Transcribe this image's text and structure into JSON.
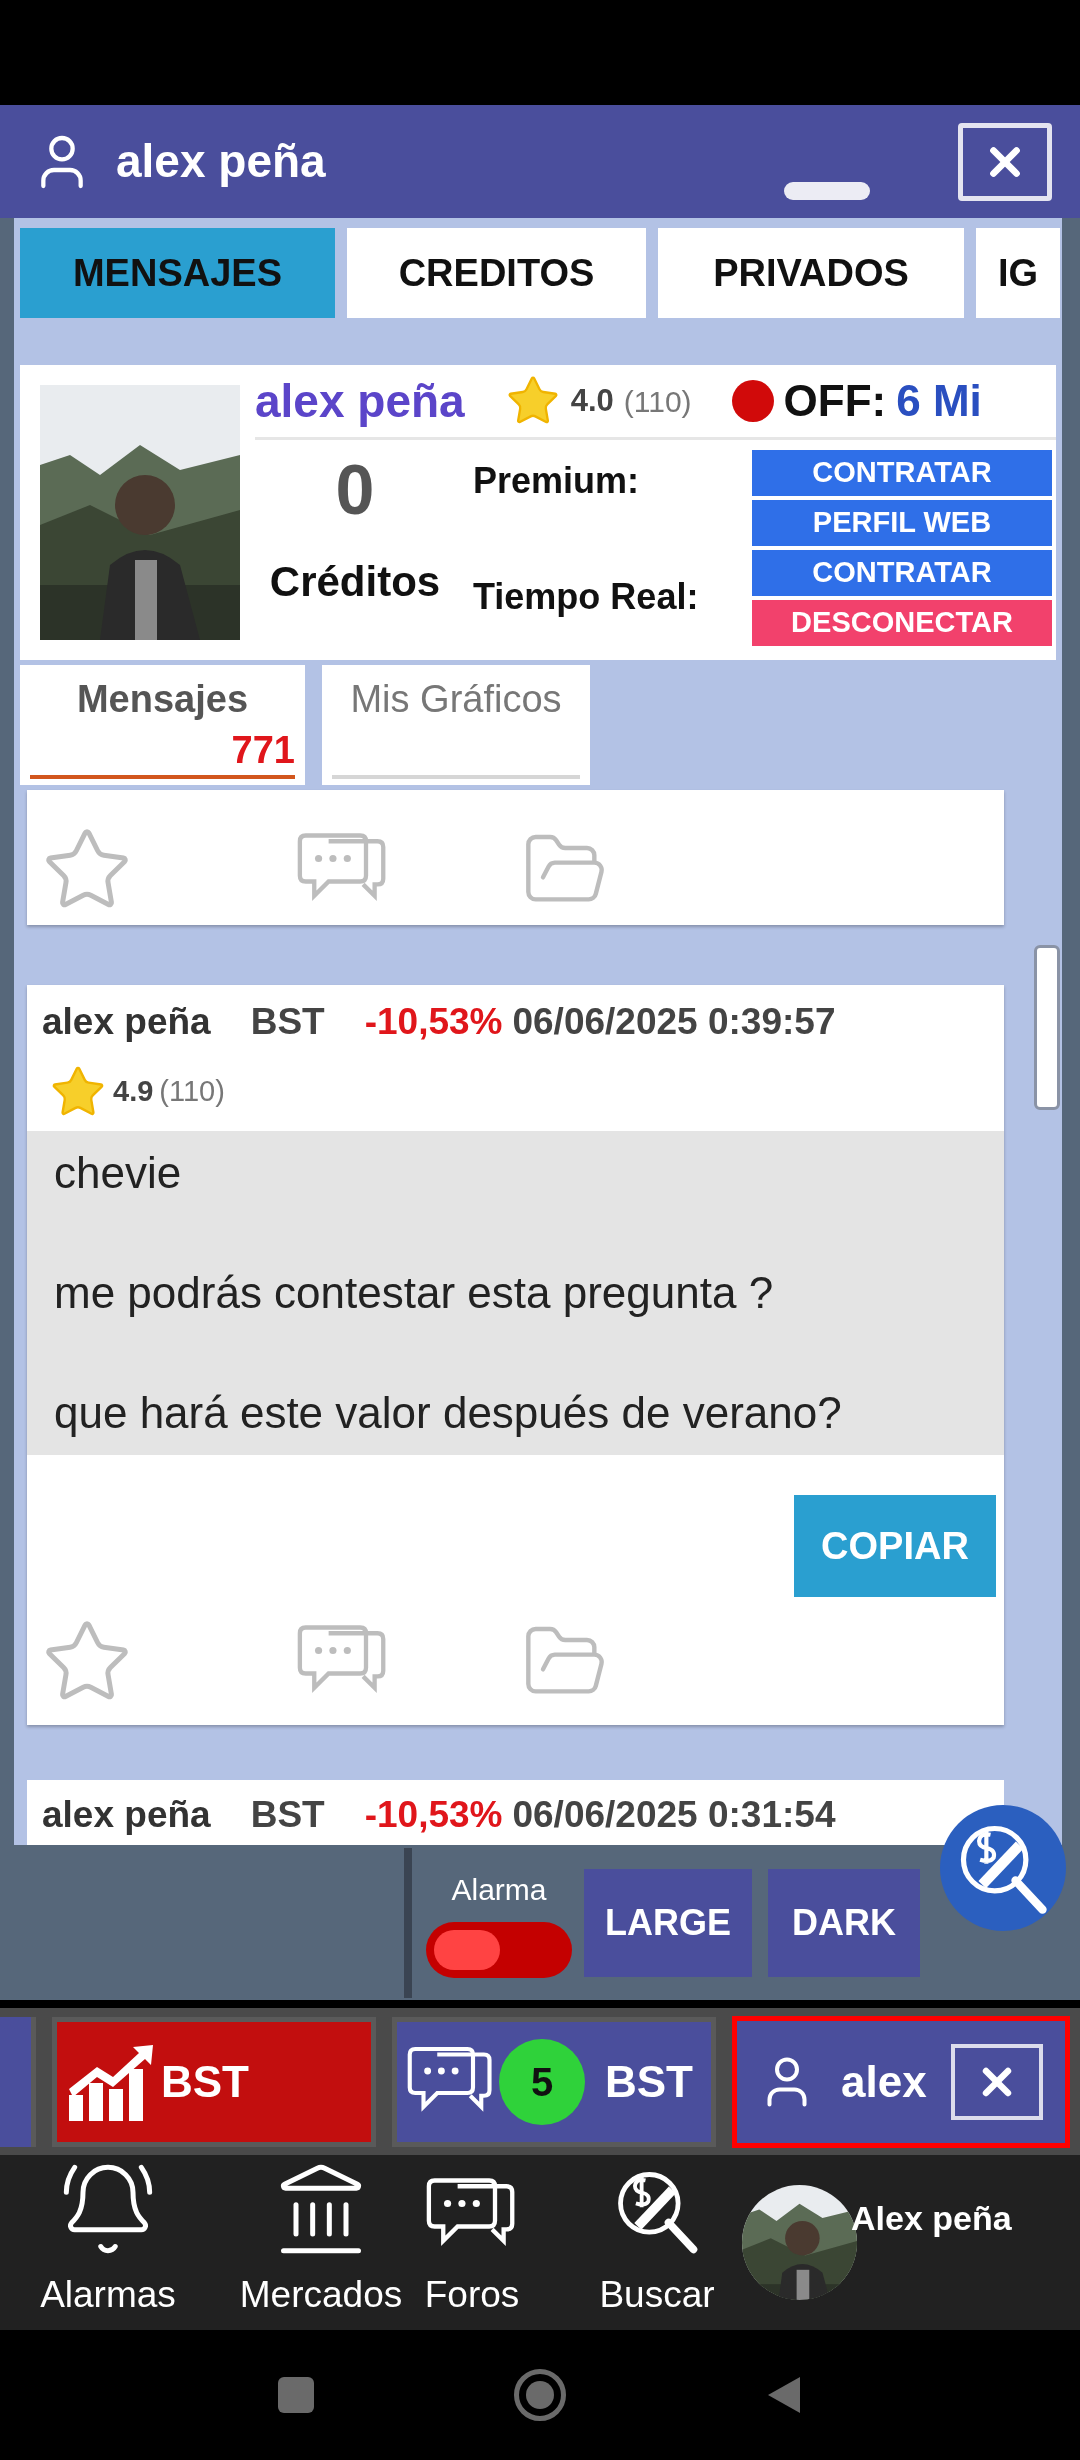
{
  "window": {
    "title": "alex peña"
  },
  "tabs": [
    {
      "label": "MENSAJES",
      "selected": true
    },
    {
      "label": "CREDITOS",
      "selected": false
    },
    {
      "label": "PRIVADOS",
      "selected": false
    },
    {
      "label": "IG",
      "selected": false
    }
  ],
  "profile": {
    "name": "alex peña",
    "rating": "4.0",
    "rating_count": "(110)",
    "online": false,
    "status": "OFF:",
    "status_detail": "6 Mi",
    "credits": "0",
    "credits_label": "Créditos",
    "premium_label": "Premium:",
    "premium_button": "CONTRATAR",
    "web_button": "PERFIL WEB",
    "realtime_label": "Tiempo Real:",
    "realtime_button": "CONTRATAR",
    "disconnect_button": "DESCONECTAR"
  },
  "subtabs": [
    {
      "label": "Mensajes",
      "count": "771",
      "selected": true
    },
    {
      "label": "Mis Gráficos",
      "selected": false
    }
  ],
  "messages": [
    {
      "kind": "tail"
    },
    {
      "kind": "full",
      "author": "alex peña",
      "symbol": "BST",
      "change": "-10,53%",
      "date": "06/06/2025 0:39:57",
      "rating": "4.9",
      "rating_count": "(110)",
      "lines": [
        "chevie",
        "me podrás contestar esta pregunta ?",
        "que hará este valor después de verano?"
      ],
      "button": "COPIAR"
    },
    {
      "kind": "head",
      "author": "alex peña",
      "symbol": "BST",
      "change": "-10,53%",
      "date": "06/06/2025 0:31:54"
    }
  ],
  "toolbar": {
    "alarm_label": "Alarma",
    "alarm_on": false,
    "buttons": [
      "LARGE",
      "DARK"
    ]
  },
  "task_tabs": [
    {
      "kind": "chart",
      "label": "BST",
      "selected": false
    },
    {
      "kind": "forum",
      "label": "BST",
      "badge": "5",
      "selected": false
    },
    {
      "kind": "user",
      "label": "alex",
      "selected": true
    }
  ],
  "bottom_nav": [
    {
      "kind": "alarm",
      "label": "Alarmas"
    },
    {
      "kind": "market",
      "label": "Mercados"
    },
    {
      "kind": "forum",
      "label": "Foros"
    },
    {
      "kind": "search",
      "label": "Buscar"
    }
  ],
  "account": {
    "name": "Alex peña"
  }
}
